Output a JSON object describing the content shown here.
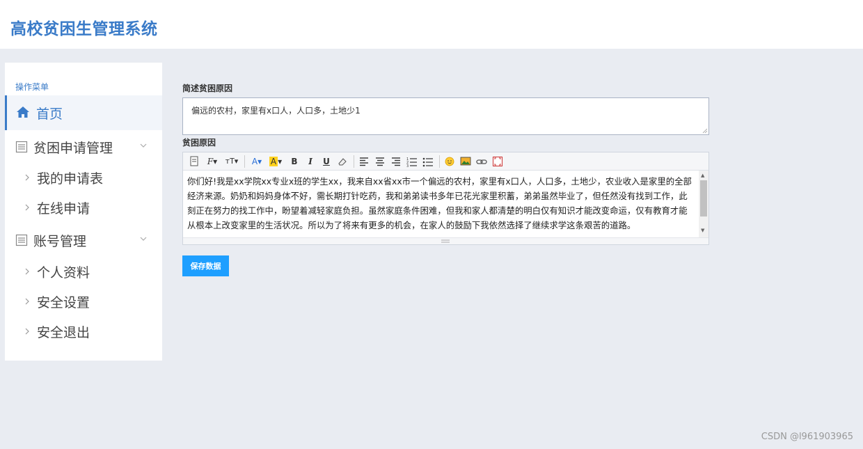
{
  "header": {
    "title": "高校贫困生管理系统"
  },
  "sidebar": {
    "menu_header": "操作菜单",
    "home_label": "首页",
    "groups": [
      {
        "label": "贫困申请管理",
        "icon": "list-icon",
        "items": [
          "我的申请表",
          "在线申请"
        ]
      },
      {
        "label": "账号管理",
        "icon": "list-icon",
        "items": [
          "个人资料",
          "安全设置",
          "安全退出"
        ]
      }
    ]
  },
  "form": {
    "summary_label": "简述贫困原因",
    "summary_value": "偏远的农村，家里有x口人，人口多，土地少1",
    "reason_label": "贫困原因",
    "reason_text": "你们好!我是xx学院xx专业x班的学生xx，我来自xx省xx市一个偏远的农村，家里有x口人，人口多，土地少，农业收入是家里的全部经济来源。奶奶和妈妈身体不好，需长期打针吃药，我和弟弟读书多年已花光家里积蓄，弟弟虽然毕业了，但任然没有找到工作，此刻正在努力的找工作中，盼望着减轻家庭负担。虽然家庭条件困难，但我和家人都清楚的明白仅有知识才能改变命运，仅有教育才能从根本上改变家里的生活状况。所以为了将来有更多的机会，在家人的鼓励下我依然选择了继续求学这条艰苦的道路。",
    "save_label": "保存数据"
  },
  "toolbar": {
    "buttons": [
      "source",
      "font-family",
      "font-size",
      "font-color",
      "background-color",
      "bold",
      "italic",
      "underline",
      "remove-format",
      "align-left",
      "align-center",
      "align-right",
      "ordered-list",
      "unordered-list",
      "emoticon",
      "image",
      "link",
      "fullscreen"
    ],
    "bold_glyph": "B",
    "italic_glyph": "I",
    "underline_glyph": "U",
    "font_color_glyph": "A",
    "bg_color_glyph": "A",
    "font_family_glyph": "F",
    "font_size_glyph": "тT"
  },
  "colors": {
    "accent": "#3a7bc8",
    "button": "#1e9fff",
    "background": "#e9ecf2"
  },
  "watermark": "CSDN @l961903965"
}
